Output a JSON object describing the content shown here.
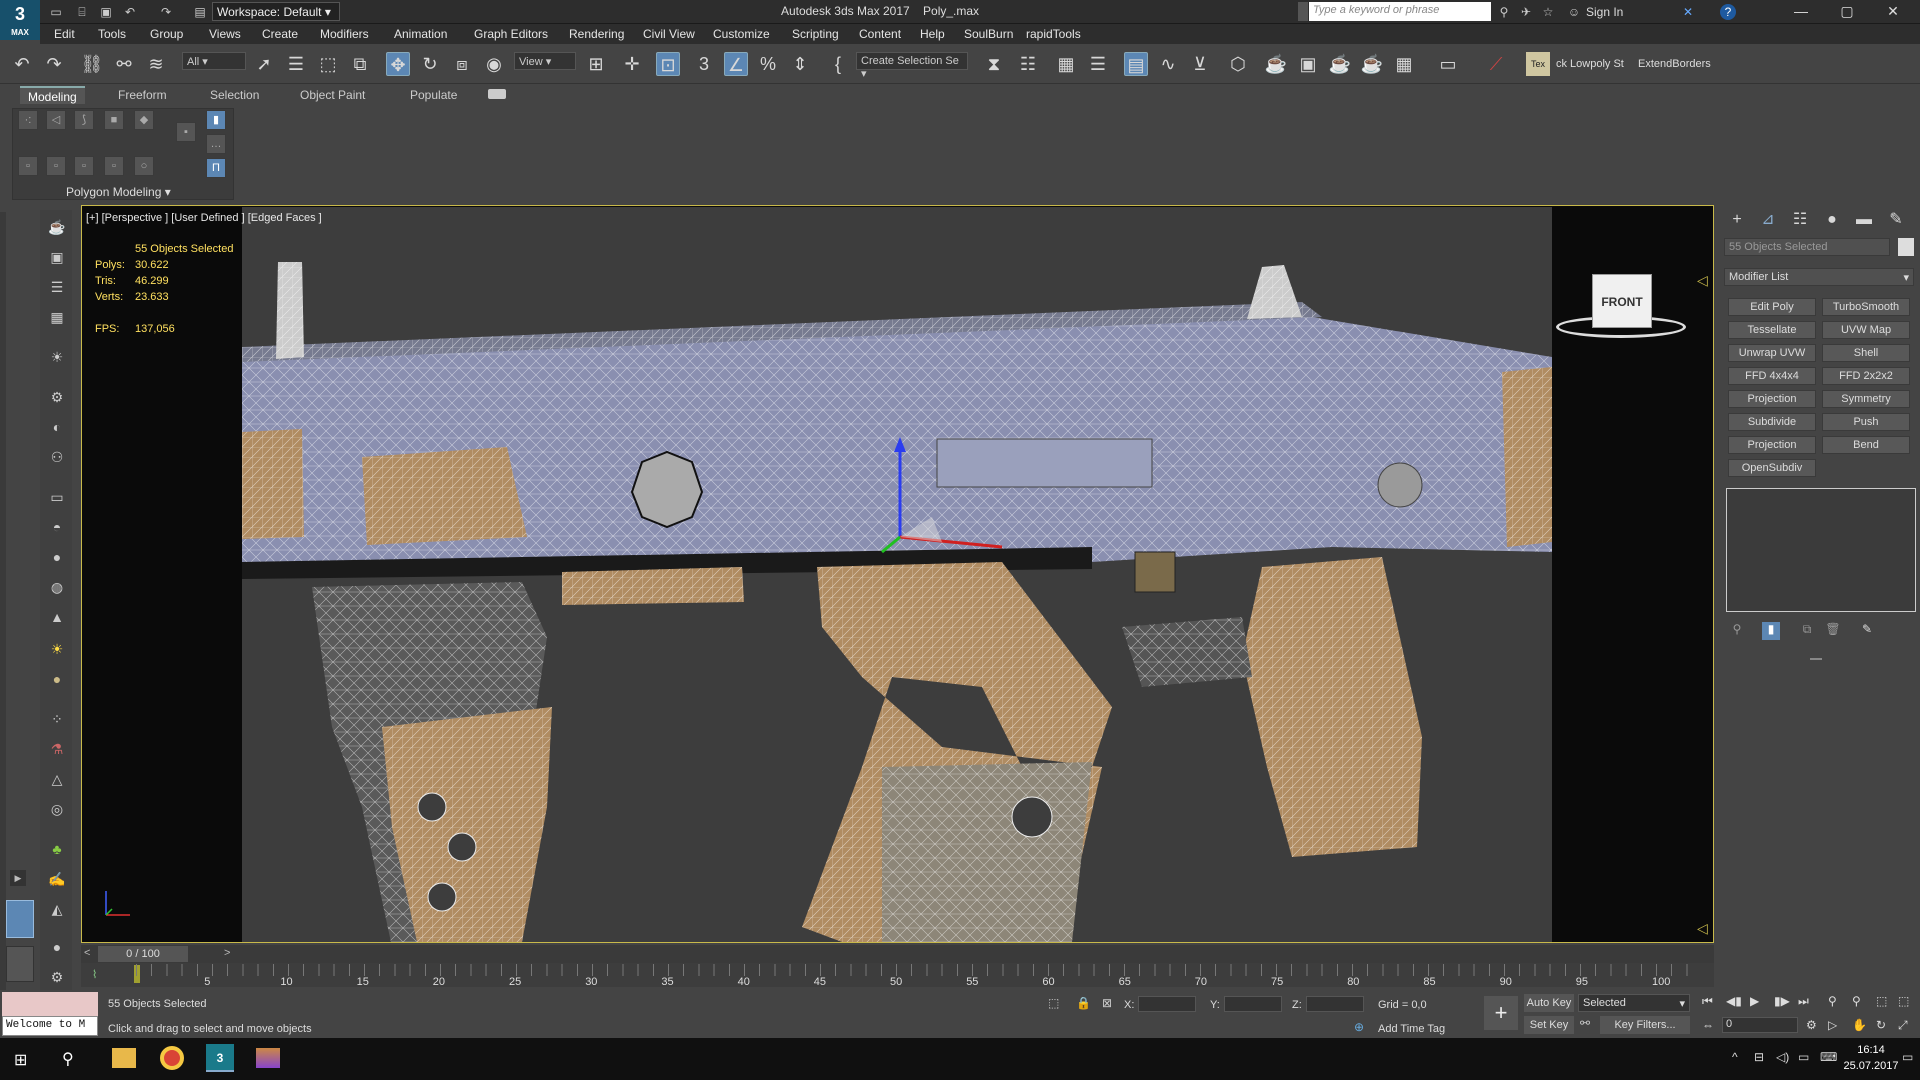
{
  "app": {
    "title": "Autodesk 3ds Max 2017",
    "file": "Poly_.max",
    "logo_text": "3",
    "logo_sub": "MAX",
    "workspace_label": "Workspace: Default",
    "search_placeholder": "Type a keyword or phrase",
    "sign_in": "Sign In"
  },
  "menus": [
    "Edit",
    "Tools",
    "Group",
    "Views",
    "Create",
    "Modifiers",
    "Animation",
    "Graph Editors",
    "Rendering",
    "Civil View",
    "Customize",
    "Scripting",
    "Content",
    "Help",
    "SoulBurn",
    "rapidTools"
  ],
  "toolbar": {
    "filter": "All",
    "ref_coord": "View",
    "selection_set": "Create Selection Se",
    "script_label1": "ck Lowpoly St",
    "script_label2": "ExtendBorders"
  },
  "ribbon": {
    "tabs": [
      "Modeling",
      "Freeform",
      "Selection",
      "Object Paint",
      "Populate"
    ],
    "panel_label": "Polygon Modeling"
  },
  "viewport": {
    "label": "[+] [Perspective ] [User Defined ] [Edged Faces ]",
    "selection": "55 Objects Selected",
    "stats": [
      {
        "label": "Polys:",
        "value": "30.622"
      },
      {
        "label": "Tris:",
        "value": "46.299"
      },
      {
        "label": "Verts:",
        "value": "23.633"
      }
    ],
    "fps_label": "FPS:",
    "fps": "137,056",
    "viewcube": "FRONT"
  },
  "command_panel": {
    "selection": "55 Objects Selected",
    "modifier_list": "Modifier List",
    "buttons": [
      "Edit Poly",
      "TurboSmooth",
      "Tessellate",
      "UVW Map",
      "Unwrap UVW",
      "Shell",
      "FFD 4x4x4",
      "FFD 2x2x2",
      "Projection",
      "Symmetry",
      "Subdivide",
      "Push",
      "Projection",
      "Bend",
      "OpenSubdiv"
    ]
  },
  "timeline": {
    "frame": "0 / 100",
    "ticks": [
      "5",
      "10",
      "15",
      "20",
      "25",
      "30",
      "35",
      "40",
      "45",
      "50",
      "55",
      "60",
      "65",
      "70",
      "75",
      "80",
      "85",
      "90",
      "95",
      "100"
    ]
  },
  "status": {
    "maxscript": "Welcome to M",
    "selection": "55 Objects Selected",
    "prompt": "Click and drag to select and move objects",
    "x_label": "X:",
    "y_label": "Y:",
    "z_label": "Z:",
    "grid": "Grid = 0,0",
    "add_time_tag": "Add Time Tag",
    "auto_key": "Auto Key",
    "selected": "Selected",
    "set_key": "Set Key",
    "key_filters": "Key Filters...",
    "frame_field": "0"
  },
  "taskbar": {
    "time": "16:14",
    "date": "25.07.2017"
  },
  "colors": {
    "viewport_border": "#c8b94a",
    "wire_tan": "#b08c62",
    "wire_blue": "#8a8fb0",
    "accent_blue": "#5c87b4"
  }
}
